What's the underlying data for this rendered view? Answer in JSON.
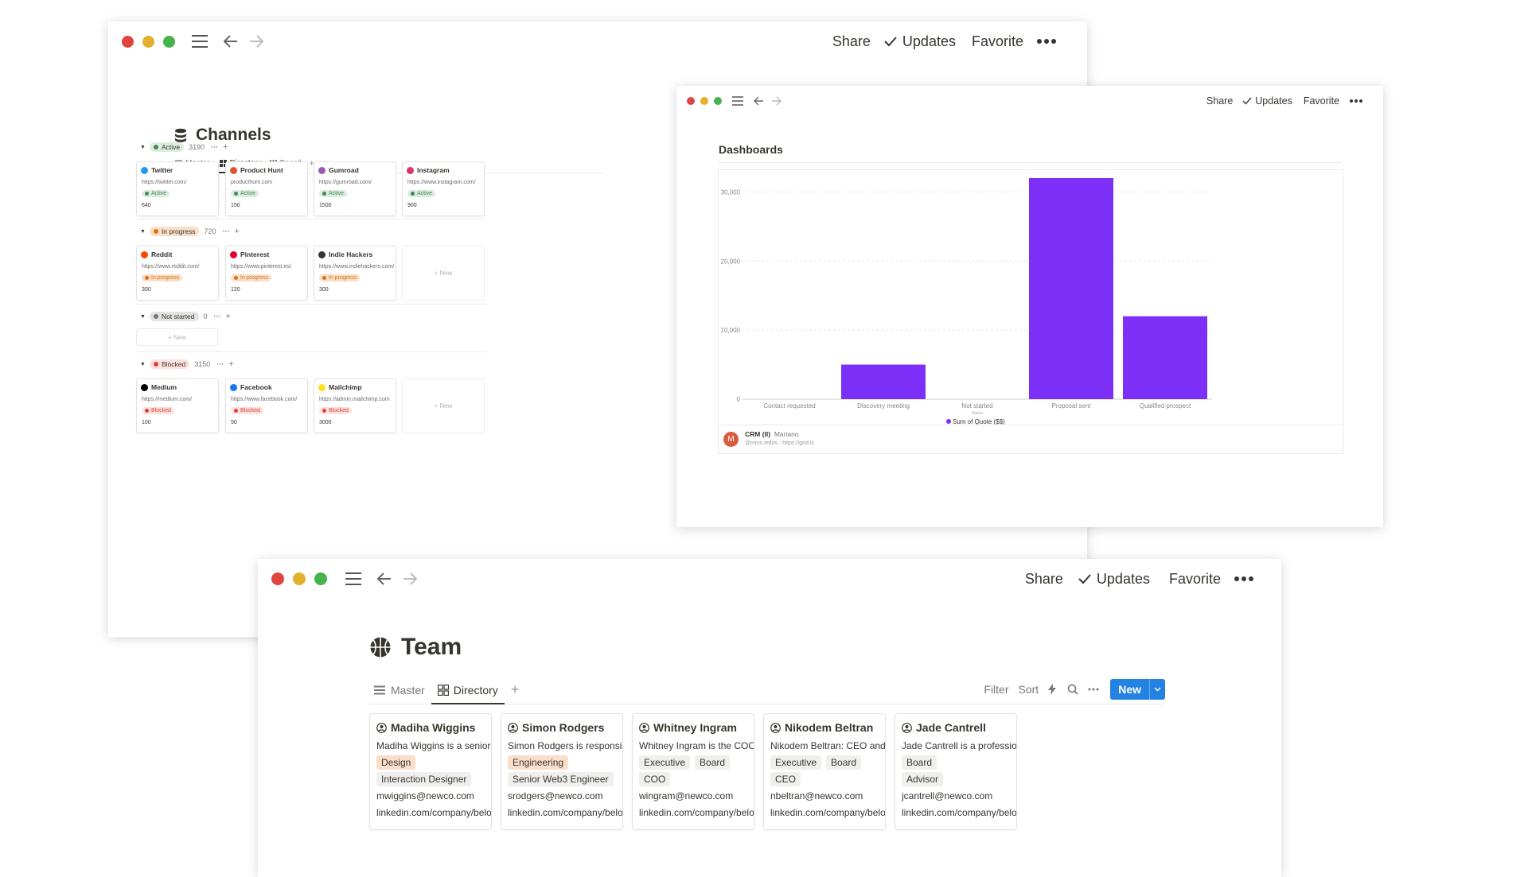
{
  "toolbar": {
    "share": "Share",
    "updates": "Updates",
    "favorite": "Favorite"
  },
  "channels": {
    "title": "Channels",
    "tabs": [
      "Master",
      "Directory",
      "Board"
    ],
    "groups": [
      {
        "label": "Active",
        "count": "3190",
        "color": "#448361",
        "bg": "#dbeddb",
        "cards": [
          {
            "name": "Twitter",
            "url": "https://twitter.com/",
            "status": "Active",
            "value": "640",
            "icon_color": "#1d9bf0"
          },
          {
            "name": "Product Hunt",
            "url": "producthunt.com",
            "status": "Active",
            "value": "150",
            "icon_color": "#da552f"
          },
          {
            "name": "Gumroad",
            "url": "https://gumroad.com/",
            "status": "Active",
            "value": "1500",
            "icon_color": "#9b59b6"
          },
          {
            "name": "Instagram",
            "url": "https://www.instagram.com/",
            "status": "Active",
            "value": "900",
            "icon_color": "#e1306c"
          }
        ]
      },
      {
        "label": "In progress",
        "count": "720",
        "color": "#d9730d",
        "bg": "#fadec9",
        "cards": [
          {
            "name": "Reddit",
            "url": "https://www.reddit.com/",
            "status": "In progress",
            "value": "300",
            "icon_color": "#ff4500"
          },
          {
            "name": "Pinterest",
            "url": "https://www.pinterest.es/",
            "status": "In progress",
            "value": "120",
            "icon_color": "#e60023"
          },
          {
            "name": "Indie Hackers",
            "url": "https://www.indiehackers.com/",
            "status": "In progress",
            "value": "300",
            "icon_color": "#333333"
          }
        ]
      },
      {
        "label": "Not started",
        "count": "0",
        "color": "#787774",
        "bg": "#e3e2e0",
        "cards": []
      },
      {
        "label": "Blocked",
        "count": "3150",
        "color": "#e03e3e",
        "bg": "#ffe2dd",
        "cards": [
          {
            "name": "Medium",
            "url": "https://medium.com/",
            "status": "Blocked",
            "value": "100",
            "icon_color": "#000000"
          },
          {
            "name": "Facebook",
            "url": "https://www.facebook.com/",
            "status": "Blocked",
            "value": "50",
            "icon_color": "#1877f2"
          },
          {
            "name": "Mailchimp",
            "url": "https://admin.mailchimp.com",
            "status": "Blocked",
            "value": "3000",
            "icon_color": "#ffe01b"
          }
        ]
      }
    ],
    "new_label": "New"
  },
  "dashboard": {
    "title": "Dashboards",
    "footer": {
      "avatar": "M",
      "name": "CRM (II)",
      "author": "Mariano",
      "sub": "@mms.eidos · https://grid.is"
    }
  },
  "chart_data": {
    "type": "bar",
    "categories": [
      "Contact requested",
      "Discovery meeting",
      "Not started",
      "Proposal sent",
      "Qualified prospect"
    ],
    "series": [
      {
        "name": "Sum of Quote ($$)",
        "values": [
          0,
          5000,
          0,
          32000,
          12000
        ],
        "color": "#7b2ff7"
      }
    ],
    "xlabel": "Status",
    "ylim": [
      0,
      32000
    ],
    "yticks": [
      0,
      10000,
      20000,
      30000
    ],
    "ytick_labels": [
      "0",
      "10,000",
      "20,000",
      "30,000"
    ],
    "legend_position": "bottom",
    "grid": true
  },
  "team": {
    "title": "Team",
    "tabs": [
      "Master",
      "Directory"
    ],
    "actions": {
      "filter": "Filter",
      "sort": "Sort",
      "new": "New"
    },
    "members": [
      {
        "name": "Madiha Wiggins",
        "desc": "Madiha Wiggins is a senior inter",
        "tags1": [
          {
            "t": "Design",
            "c": "#fadec9"
          }
        ],
        "tags2": [
          {
            "t": "Interaction Designer",
            "c": "#efefed"
          }
        ],
        "email": "mwiggins@newco.com",
        "linkedin": "linkedin.com/company/belowno"
      },
      {
        "name": "Simon Rodgers",
        "desc": "Simon Rodgers is responsible fo",
        "tags1": [
          {
            "t": "Engineering",
            "c": "#fadec9"
          }
        ],
        "tags2": [
          {
            "t": "Senior Web3 Engineer",
            "c": "#efefed"
          }
        ],
        "email": "srodgers@newco.com",
        "linkedin": "linkedin.com/company/belowno"
      },
      {
        "name": "Whitney Ingram",
        "desc": "Whitney Ingram is the COO of N",
        "tags1": [
          {
            "t": "Executive",
            "c": "#efefed"
          },
          {
            "t": "Board",
            "c": "#efefed"
          }
        ],
        "tags2": [
          {
            "t": "COO",
            "c": "#efefed"
          }
        ],
        "email": "wingram@newco.com",
        "linkedin": "linkedin.com/company/belowno"
      },
      {
        "name": "Nikodem Beltran",
        "desc": "Nikodem Beltran: CEO and foun",
        "tags1": [
          {
            "t": "Executive",
            "c": "#efefed"
          },
          {
            "t": "Board",
            "c": "#efefed"
          }
        ],
        "tags2": [
          {
            "t": "CEO",
            "c": "#efefed"
          }
        ],
        "email": "nbeltran@newco.com",
        "linkedin": "linkedin.com/company/belowno"
      },
      {
        "name": "Jade Cantrell",
        "desc": "Jade Cantrell is a professional v",
        "tags1": [
          {
            "t": "Board",
            "c": "#efefed"
          }
        ],
        "tags2": [
          {
            "t": "Advisor",
            "c": "#efefed"
          }
        ],
        "email": "jcantrell@newco.com",
        "linkedin": "linkedin.com/company/belowno"
      }
    ]
  },
  "colors": {
    "red": "#e0443e",
    "yellow": "#e2b02c",
    "green": "#46b34c",
    "accent": "#2383e2",
    "bar": "#7b2ff7"
  },
  "icons": [
    "hamburger-icon",
    "back-arrow-icon",
    "forward-arrow-icon",
    "check-icon",
    "more-icon",
    "database-icon",
    "basketball-icon",
    "person-icon",
    "search-icon",
    "lightning-icon",
    "plus-icon",
    "chevron-down-icon"
  ]
}
